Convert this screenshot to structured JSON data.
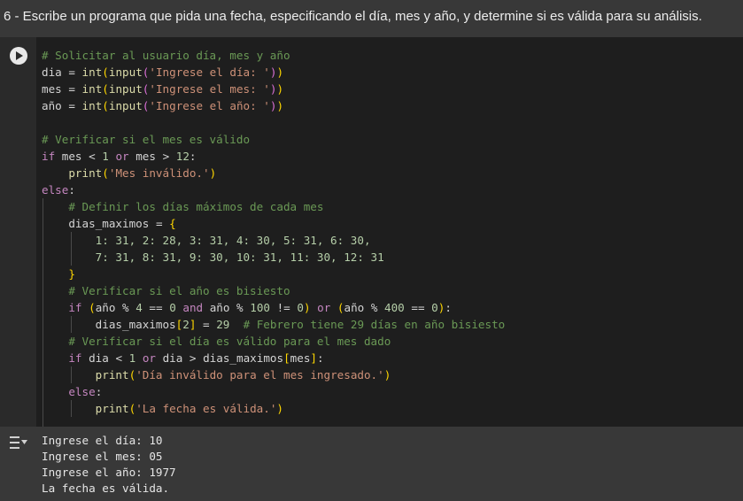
{
  "heading": "6 - Escribe un programa que pida una fecha, especificando el día, mes y año, y determine si es válida para su análisis.",
  "code": {
    "l1": "# Solicitar al usuario día, mes y año",
    "l2_var": "dia",
    "l2_prompt": "'Ingrese el día: '",
    "l3_var": "mes",
    "l3_prompt": "'Ingrese el mes: '",
    "l4_var": "año",
    "l4_prompt": "'Ingrese el año: '",
    "l6": "# Verificar si el mes es válido",
    "l8_str": "'Mes inválido.'",
    "l10": "# Definir los días máximos de cada mes",
    "l11_var": "dias_maximos",
    "l12": "1: 31, 2: 28, 3: 31, 4: 30, 5: 31, 6: 30,",
    "l13": "7: 31, 8: 31, 9: 30, 10: 31, 11: 30, 12: 31",
    "l15": "# Verificar si el año es bisiesto",
    "l17_comment": "# Febrero tiene 29 días en año bisiesto",
    "l18": "# Verificar si el día es válido para el mes dado",
    "l20_str": "'Día inválido para el mes ingresado.'",
    "l22_str": "'La fecha es válida.'"
  },
  "output": {
    "icon": "output-collapse-icon",
    "lines": [
      "Ingrese el día: 10",
      "Ingrese el mes: 05",
      "Ingrese el año: 1977",
      "La fecha es válida."
    ]
  }
}
